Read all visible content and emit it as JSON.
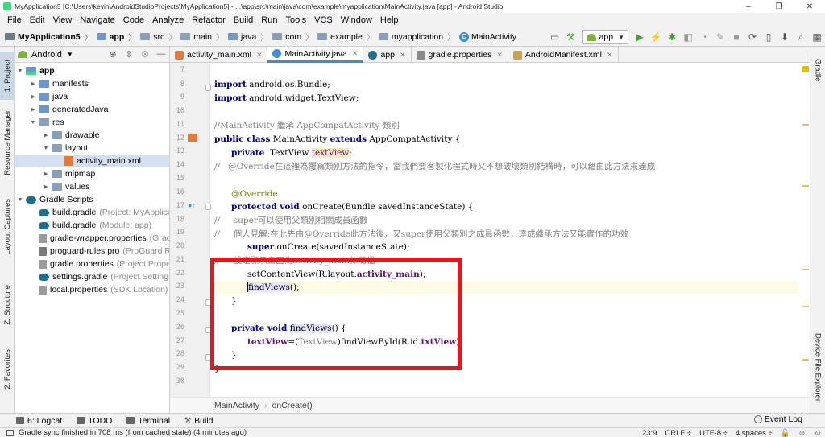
{
  "window": {
    "title": "MyApplication5 [C:\\Users\\kevin\\AndroidStudioProjects\\MyApplication5] - ...\\app\\src\\main\\java\\com\\example\\myapplication\\MainActivity.java [app] - Android Studio",
    "minimize": "–",
    "maximize": "❐",
    "close": "✕"
  },
  "menu": [
    "File",
    "Edit",
    "View",
    "Navigate",
    "Code",
    "Analyze",
    "Refactor",
    "Build",
    "Run",
    "Tools",
    "VCS",
    "Window",
    "Help"
  ],
  "nav": {
    "crumbs": [
      "MyApplication5",
      "app",
      "src",
      "main",
      "java",
      "com",
      "example",
      "myapplication",
      "MainActivity"
    ],
    "run_config": "app"
  },
  "left_tabs": [
    "1: Project",
    "Resource Manager",
    "Layout Captures",
    "Z: Structure",
    "2: Favorites"
  ],
  "right_tabs": [
    "Gradle",
    "Device File Explorer"
  ],
  "project_panel": {
    "view": "Android",
    "tree": [
      {
        "label": "app",
        "hint": ""
      },
      {
        "label": "manifests",
        "hint": ""
      },
      {
        "label": "java",
        "hint": ""
      },
      {
        "label": "generatedJava",
        "hint": ""
      },
      {
        "label": "res",
        "hint": ""
      },
      {
        "label": "drawable",
        "hint": ""
      },
      {
        "label": "layout",
        "hint": ""
      },
      {
        "label": "activity_main.xml",
        "hint": ""
      },
      {
        "label": "mipmap",
        "hint": ""
      },
      {
        "label": "values",
        "hint": ""
      },
      {
        "label": "Gradle Scripts",
        "hint": ""
      },
      {
        "label": "build.gradle",
        "hint": "(Project: MyApplica"
      },
      {
        "label": "build.gradle",
        "hint": "(Module: app)"
      },
      {
        "label": "gradle-wrapper.properties",
        "hint": "(Grac"
      },
      {
        "label": "proguard-rules.pro",
        "hint": "(ProGuard R"
      },
      {
        "label": "gradle.properties",
        "hint": "(Project Prope"
      },
      {
        "label": "settings.gradle",
        "hint": "(Project Settings"
      },
      {
        "label": "local.properties",
        "hint": "(SDK Location)"
      }
    ]
  },
  "editor_tabs": [
    "activity_main.xml",
    "MainActivity.java",
    "app",
    "gradle.properties",
    "AndroidManifest.xml"
  ],
  "line_numbers": [
    "7",
    "8",
    "9",
    "10",
    "11",
    "12",
    "13",
    "14",
    "15",
    "16",
    "17",
    "18",
    "19",
    "20",
    "21",
    "22",
    "23",
    "24",
    "25",
    "26",
    "27",
    "28",
    "29",
    "30"
  ],
  "code": {
    "l8_kw": "import",
    "l8_rest": " android.os.Bundle;",
    "l9_kw": "import",
    "l9_rest": " android.widget.TextView;",
    "l11": "//MainActivity 繼承 AppCompatActivity 類別",
    "l12_kw1": "public class",
    "l12_mid": " MainActivity ",
    "l12_kw2": "extends",
    "l12_end": " AppCompatActivity {",
    "l13_kw": "private",
    "l13_mid": "  TextView ",
    "l13_fld": "textView",
    "l13_end": ";",
    "l14": "//   @Override在這裡為覆寫類別方法的指令，當我們要客製化程式時又不想破壞類別結構時，可以藉由此方法來達成",
    "l16": "@Override",
    "l17_kw": "protected void",
    "l17_rest": " onCreate(Bundle savedInstanceState) {",
    "l18": "//     super可以使用父類別相關成員函數",
    "l19": "//     個人見解:在此先由@Override此方法後，又super使用父類別之成員函數，達成繼承方法又能實作的功效",
    "l20_kw": "super",
    "l20_rest": ".onCreate(savedInstanceState);",
    "l21": "//     設定顯示畫面為activity_main佈局檔",
    "l22_a": "setContentView(R.layout.",
    "l22_fld": "activity_main",
    "l22_b": ");",
    "l23_fn": "findViews",
    "l23_b": "();",
    "l24": "}",
    "l26_kw": "private void",
    "l26_fn": "findViews",
    "l26_b": "() {",
    "l27_fld": "textView",
    "l27_a": "=(",
    "l27_cast": "TextView",
    "l27_b": ")findViewById(R.id.",
    "l27_fld2": "txtView",
    "l27_c": ");",
    "l28": "}",
    "l29": "}"
  },
  "editor_breadcrumb": [
    "MainActivity",
    "onCreate()"
  ],
  "bottom_tools": [
    "6: Logcat",
    "TODO",
    "Terminal",
    "Build"
  ],
  "event_log": "Event Log",
  "status": {
    "message": "Gradle sync finished in 708 ms (from cached state) (4 minutes ago)",
    "position": "23:9",
    "line_sep": "CRLF ÷",
    "encoding": "UTF-8 ÷",
    "indent": "4 spaces ÷"
  },
  "colors": {
    "highlight_box": "#e0191e",
    "keyword": "#000080",
    "comment": "#808080",
    "annotation": "#808000",
    "field": "#660e7a"
  }
}
